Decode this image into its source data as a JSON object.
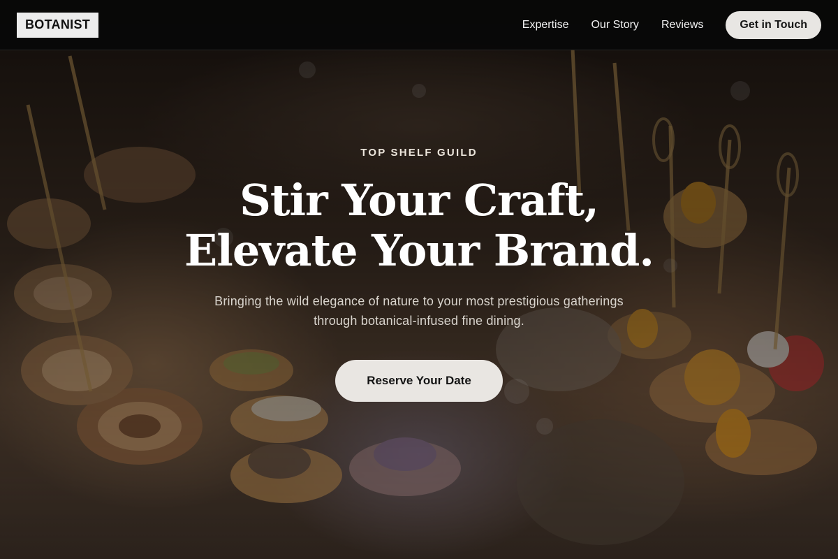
{
  "header": {
    "logo": "BOTANIST",
    "nav": [
      {
        "label": "Expertise"
      },
      {
        "label": "Our Story"
      },
      {
        "label": "Reviews"
      }
    ],
    "contact_button": "Get in Touch"
  },
  "hero": {
    "eyebrow": "TOP SHELF GUILD",
    "headline_line1": "Stir Your Craft,",
    "headline_line2": "Elevate Your Brand.",
    "subtitle": "Bringing the wild elegance of nature to your most prestigious gatherings through botanical-infused fine dining.",
    "cta": "Reserve Your Date",
    "background": "catering-appetizers-photo"
  },
  "colors": {
    "header_bg": "#080808",
    "button_bg": "#e9e6e2",
    "text_light": "#ffffff"
  }
}
